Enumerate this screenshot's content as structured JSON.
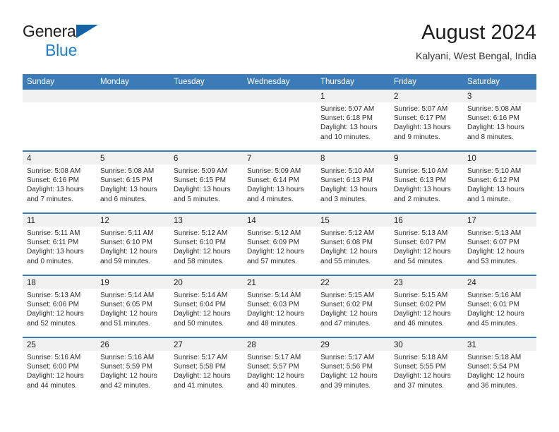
{
  "brand": {
    "name_top": "General",
    "name_bottom": "Blue",
    "flag_color": "#1464a5",
    "blue_text_color": "#1b7fd4"
  },
  "header": {
    "title": "August 2024",
    "location": "Kalyani, West Bengal, India"
  },
  "theme": {
    "header_blue": "#3b7cb8",
    "band_gray": "#f0f0f0",
    "text": "#1b1b1b"
  },
  "weekdays": [
    "Sunday",
    "Monday",
    "Tuesday",
    "Wednesday",
    "Thursday",
    "Friday",
    "Saturday"
  ],
  "weeks": [
    [
      {
        "day": "",
        "sunrise": "",
        "sunset": "",
        "daylight1": "",
        "daylight2": ""
      },
      {
        "day": "",
        "sunrise": "",
        "sunset": "",
        "daylight1": "",
        "daylight2": ""
      },
      {
        "day": "",
        "sunrise": "",
        "sunset": "",
        "daylight1": "",
        "daylight2": ""
      },
      {
        "day": "",
        "sunrise": "",
        "sunset": "",
        "daylight1": "",
        "daylight2": ""
      },
      {
        "day": "1",
        "sunrise": "Sunrise: 5:07 AM",
        "sunset": "Sunset: 6:18 PM",
        "daylight1": "Daylight: 13 hours",
        "daylight2": "and 10 minutes."
      },
      {
        "day": "2",
        "sunrise": "Sunrise: 5:07 AM",
        "sunset": "Sunset: 6:17 PM",
        "daylight1": "Daylight: 13 hours",
        "daylight2": "and 9 minutes."
      },
      {
        "day": "3",
        "sunrise": "Sunrise: 5:08 AM",
        "sunset": "Sunset: 6:16 PM",
        "daylight1": "Daylight: 13 hours",
        "daylight2": "and 8 minutes."
      }
    ],
    [
      {
        "day": "4",
        "sunrise": "Sunrise: 5:08 AM",
        "sunset": "Sunset: 6:16 PM",
        "daylight1": "Daylight: 13 hours",
        "daylight2": "and 7 minutes."
      },
      {
        "day": "5",
        "sunrise": "Sunrise: 5:08 AM",
        "sunset": "Sunset: 6:15 PM",
        "daylight1": "Daylight: 13 hours",
        "daylight2": "and 6 minutes."
      },
      {
        "day": "6",
        "sunrise": "Sunrise: 5:09 AM",
        "sunset": "Sunset: 6:15 PM",
        "daylight1": "Daylight: 13 hours",
        "daylight2": "and 5 minutes."
      },
      {
        "day": "7",
        "sunrise": "Sunrise: 5:09 AM",
        "sunset": "Sunset: 6:14 PM",
        "daylight1": "Daylight: 13 hours",
        "daylight2": "and 4 minutes."
      },
      {
        "day": "8",
        "sunrise": "Sunrise: 5:10 AM",
        "sunset": "Sunset: 6:13 PM",
        "daylight1": "Daylight: 13 hours",
        "daylight2": "and 3 minutes."
      },
      {
        "day": "9",
        "sunrise": "Sunrise: 5:10 AM",
        "sunset": "Sunset: 6:13 PM",
        "daylight1": "Daylight: 13 hours",
        "daylight2": "and 2 minutes."
      },
      {
        "day": "10",
        "sunrise": "Sunrise: 5:10 AM",
        "sunset": "Sunset: 6:12 PM",
        "daylight1": "Daylight: 13 hours",
        "daylight2": "and 1 minute."
      }
    ],
    [
      {
        "day": "11",
        "sunrise": "Sunrise: 5:11 AM",
        "sunset": "Sunset: 6:11 PM",
        "daylight1": "Daylight: 13 hours",
        "daylight2": "and 0 minutes."
      },
      {
        "day": "12",
        "sunrise": "Sunrise: 5:11 AM",
        "sunset": "Sunset: 6:10 PM",
        "daylight1": "Daylight: 12 hours",
        "daylight2": "and 59 minutes."
      },
      {
        "day": "13",
        "sunrise": "Sunrise: 5:12 AM",
        "sunset": "Sunset: 6:10 PM",
        "daylight1": "Daylight: 12 hours",
        "daylight2": "and 58 minutes."
      },
      {
        "day": "14",
        "sunrise": "Sunrise: 5:12 AM",
        "sunset": "Sunset: 6:09 PM",
        "daylight1": "Daylight: 12 hours",
        "daylight2": "and 57 minutes."
      },
      {
        "day": "15",
        "sunrise": "Sunrise: 5:12 AM",
        "sunset": "Sunset: 6:08 PM",
        "daylight1": "Daylight: 12 hours",
        "daylight2": "and 55 minutes."
      },
      {
        "day": "16",
        "sunrise": "Sunrise: 5:13 AM",
        "sunset": "Sunset: 6:07 PM",
        "daylight1": "Daylight: 12 hours",
        "daylight2": "and 54 minutes."
      },
      {
        "day": "17",
        "sunrise": "Sunrise: 5:13 AM",
        "sunset": "Sunset: 6:07 PM",
        "daylight1": "Daylight: 12 hours",
        "daylight2": "and 53 minutes."
      }
    ],
    [
      {
        "day": "18",
        "sunrise": "Sunrise: 5:13 AM",
        "sunset": "Sunset: 6:06 PM",
        "daylight1": "Daylight: 12 hours",
        "daylight2": "and 52 minutes."
      },
      {
        "day": "19",
        "sunrise": "Sunrise: 5:14 AM",
        "sunset": "Sunset: 6:05 PM",
        "daylight1": "Daylight: 12 hours",
        "daylight2": "and 51 minutes."
      },
      {
        "day": "20",
        "sunrise": "Sunrise: 5:14 AM",
        "sunset": "Sunset: 6:04 PM",
        "daylight1": "Daylight: 12 hours",
        "daylight2": "and 50 minutes."
      },
      {
        "day": "21",
        "sunrise": "Sunrise: 5:14 AM",
        "sunset": "Sunset: 6:03 PM",
        "daylight1": "Daylight: 12 hours",
        "daylight2": "and 48 minutes."
      },
      {
        "day": "22",
        "sunrise": "Sunrise: 5:15 AM",
        "sunset": "Sunset: 6:02 PM",
        "daylight1": "Daylight: 12 hours",
        "daylight2": "and 47 minutes."
      },
      {
        "day": "23",
        "sunrise": "Sunrise: 5:15 AM",
        "sunset": "Sunset: 6:02 PM",
        "daylight1": "Daylight: 12 hours",
        "daylight2": "and 46 minutes."
      },
      {
        "day": "24",
        "sunrise": "Sunrise: 5:16 AM",
        "sunset": "Sunset: 6:01 PM",
        "daylight1": "Daylight: 12 hours",
        "daylight2": "and 45 minutes."
      }
    ],
    [
      {
        "day": "25",
        "sunrise": "Sunrise: 5:16 AM",
        "sunset": "Sunset: 6:00 PM",
        "daylight1": "Daylight: 12 hours",
        "daylight2": "and 44 minutes."
      },
      {
        "day": "26",
        "sunrise": "Sunrise: 5:16 AM",
        "sunset": "Sunset: 5:59 PM",
        "daylight1": "Daylight: 12 hours",
        "daylight2": "and 42 minutes."
      },
      {
        "day": "27",
        "sunrise": "Sunrise: 5:17 AM",
        "sunset": "Sunset: 5:58 PM",
        "daylight1": "Daylight: 12 hours",
        "daylight2": "and 41 minutes."
      },
      {
        "day": "28",
        "sunrise": "Sunrise: 5:17 AM",
        "sunset": "Sunset: 5:57 PM",
        "daylight1": "Daylight: 12 hours",
        "daylight2": "and 40 minutes."
      },
      {
        "day": "29",
        "sunrise": "Sunrise: 5:17 AM",
        "sunset": "Sunset: 5:56 PM",
        "daylight1": "Daylight: 12 hours",
        "daylight2": "and 39 minutes."
      },
      {
        "day": "30",
        "sunrise": "Sunrise: 5:18 AM",
        "sunset": "Sunset: 5:55 PM",
        "daylight1": "Daylight: 12 hours",
        "daylight2": "and 37 minutes."
      },
      {
        "day": "31",
        "sunrise": "Sunrise: 5:18 AM",
        "sunset": "Sunset: 5:54 PM",
        "daylight1": "Daylight: 12 hours",
        "daylight2": "and 36 minutes."
      }
    ]
  ]
}
